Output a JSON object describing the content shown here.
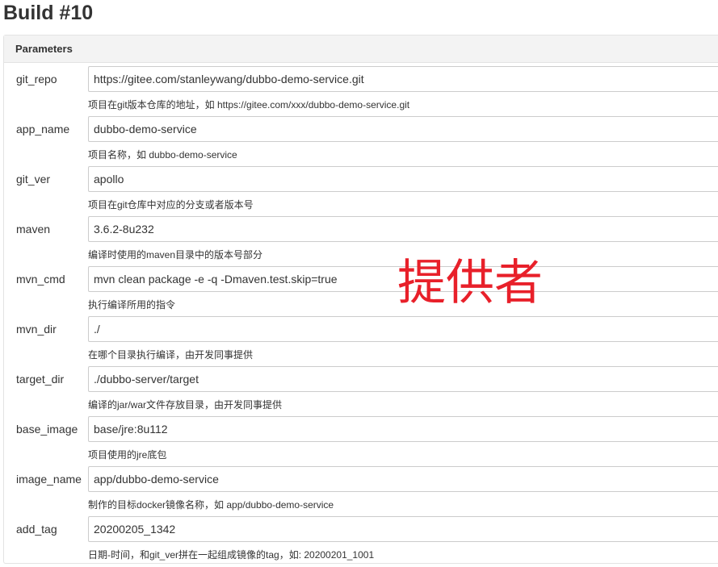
{
  "page": {
    "title": "Build #10"
  },
  "panel": {
    "header": "Parameters"
  },
  "parameters": [
    {
      "label": "git_repo",
      "value": "https://gitee.com/stanleywang/dubbo-demo-service.git",
      "description": "项目在git版本仓库的地址，如 https://gitee.com/xxx/dubbo-demo-service.git"
    },
    {
      "label": "app_name",
      "value": "dubbo-demo-service",
      "description": "项目名称，如 dubbo-demo-service"
    },
    {
      "label": "git_ver",
      "value": "apollo",
      "description": "项目在git仓库中对应的分支或者版本号"
    },
    {
      "label": "maven",
      "value": "3.6.2-8u232",
      "description": "编译时使用的maven目录中的版本号部分"
    },
    {
      "label": "mvn_cmd",
      "value": "mvn clean package -e -q -Dmaven.test.skip=true",
      "description": "执行编译所用的指令"
    },
    {
      "label": "mvn_dir",
      "value": "./",
      "description": "在哪个目录执行编译，由开发同事提供"
    },
    {
      "label": "target_dir",
      "value": "./dubbo-server/target",
      "description": "编译的jar/war文件存放目录，由开发同事提供"
    },
    {
      "label": "base_image",
      "value": "base/jre:8u112",
      "description": "项目使用的jre底包"
    },
    {
      "label": "image_name",
      "value": "app/dubbo-demo-service",
      "description": "制作的目标docker镜像名称，如 app/dubbo-demo-service"
    },
    {
      "label": "add_tag",
      "value": "20200205_1342",
      "description": "日期-时间，和git_ver拼在一起组成镜像的tag，如: 20200201_1001"
    }
  ],
  "annotation": {
    "text": "提供者",
    "color": "#e8202a"
  }
}
